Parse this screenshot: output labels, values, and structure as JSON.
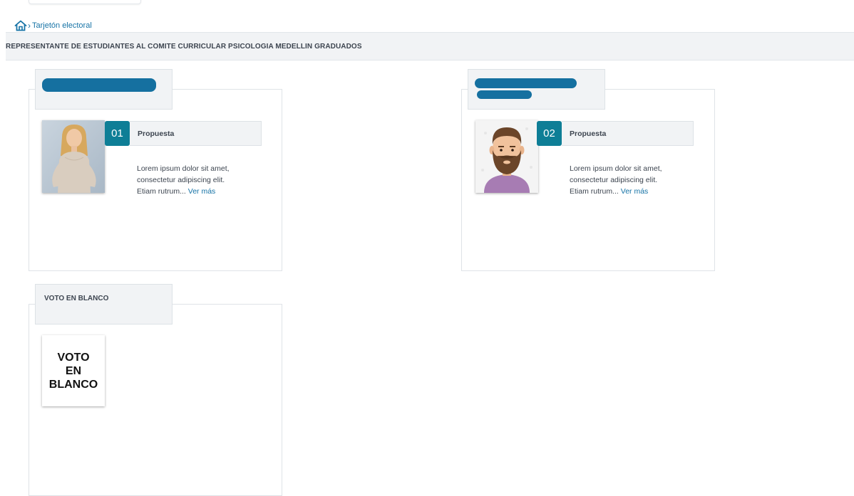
{
  "breadcrumb": {
    "label": "Tarjetón electoral",
    "separator": "›"
  },
  "section": {
    "title": "REPRESENTANTE DE ESTUDIANTES AL COMITE CURRICULAR PSICOLOGIA MEDELLIN GRADUADOS"
  },
  "candidates": [
    {
      "number": "01",
      "proposal_title": "Propuesta",
      "description_lines": [
        "Lorem ipsum dolor sit amet,",
        "consectetur adipiscing elit.",
        "Etiam rutrum..."
      ],
      "more_link": "Ver más"
    },
    {
      "number": "02",
      "proposal_title": "Propuesta",
      "description_lines": [
        "Lorem ipsum dolor sit amet,",
        "consectetur adipiscing elit.",
        "Etiam rutrum..."
      ],
      "more_link": "Ver más"
    }
  ],
  "blank_vote": {
    "title": "VOTO EN BLANCO",
    "image_lines": [
      "VOTO",
      "EN",
      "BLANCO"
    ]
  },
  "colors": {
    "accent": "#0e7e96",
    "link": "#1673a6",
    "redaction": "#1570a0",
    "panel_bg": "#f1f3f5"
  },
  "icons": {
    "home": "home-icon"
  }
}
